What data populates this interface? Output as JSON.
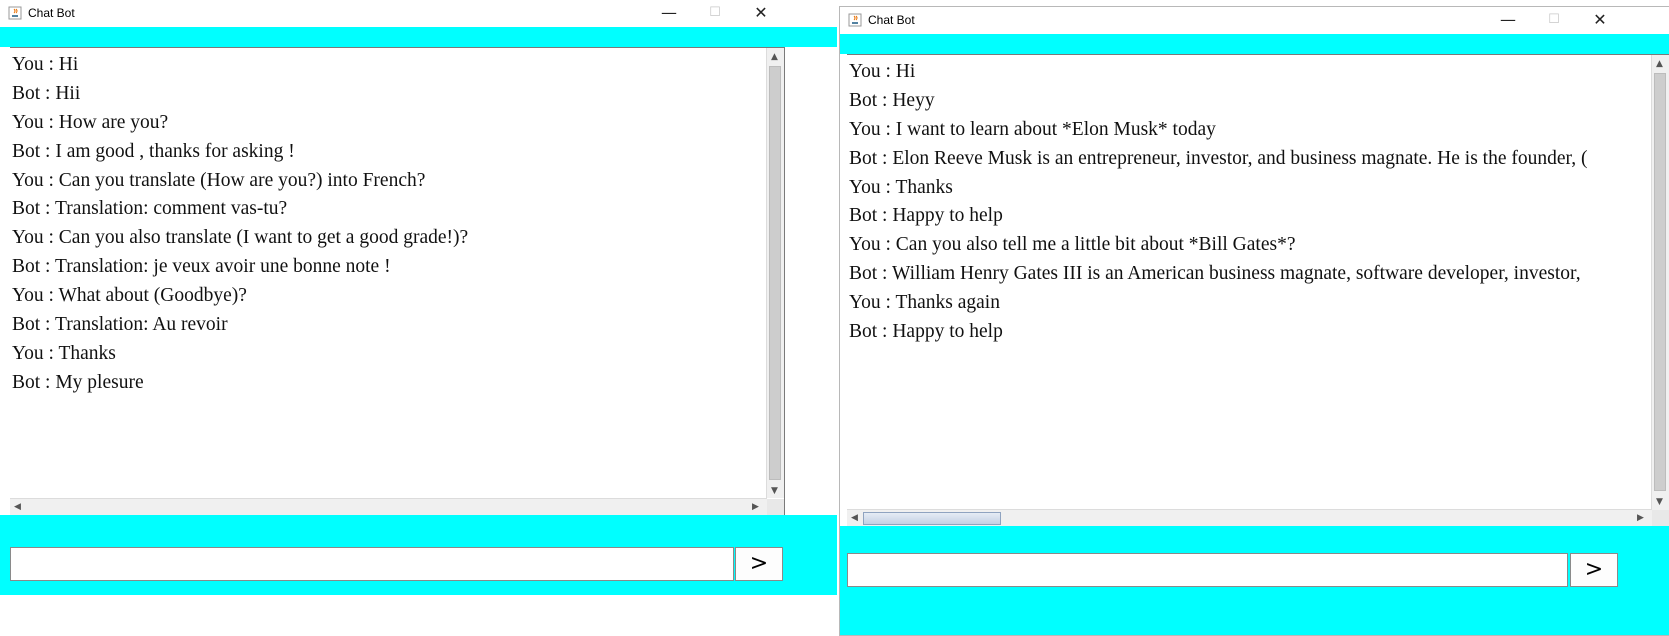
{
  "windows": [
    {
      "title": "Chat Bot",
      "controls": {
        "minimize": "—",
        "maximize": "☐",
        "close": "✕"
      },
      "messages": [
        "You : Hi",
        "Bot : Hii",
        "You : How are you?",
        "Bot : I am good , thanks for asking !",
        "You : Can you translate (How are you?) into French?",
        "Bot : Translation: comment vas-tu?",
        "You : Can you also translate (I want to get a good grade!)?",
        "Bot : Translation: je veux avoir une bonne note !",
        "You : What about (Goodbye)?",
        "Bot : Translation: Au revoir",
        "You : Thanks",
        "Bot : My plesure"
      ],
      "input": {
        "value": "",
        "placeholder": ""
      },
      "send_label": ">"
    },
    {
      "title": "Chat Bot",
      "controls": {
        "minimize": "—",
        "maximize": "☐",
        "close": "✕"
      },
      "messages": [
        "You : Hi",
        "Bot : Heyy",
        "You : I want to learn about *Elon Musk* today",
        "Bot : Elon Reeve Musk is an entrepreneur, investor, and business magnate. He is the founder, (",
        "You : Thanks",
        "Bot : Happy to help",
        "You : Can you also tell me a little bit about *Bill Gates*?",
        "Bot : William Henry Gates III is an American business magnate, software developer, investor,",
        "You : Thanks again",
        "Bot : Happy to help"
      ],
      "input": {
        "value": "",
        "placeholder": ""
      },
      "send_label": ">"
    }
  ],
  "colors": {
    "background": "#00ffff",
    "text": "#111111"
  },
  "icons": [
    "java-app-icon",
    "minimize-icon",
    "maximize-icon",
    "close-icon",
    "scroll-up-icon",
    "scroll-down-icon",
    "scroll-left-icon",
    "scroll-right-icon"
  ]
}
